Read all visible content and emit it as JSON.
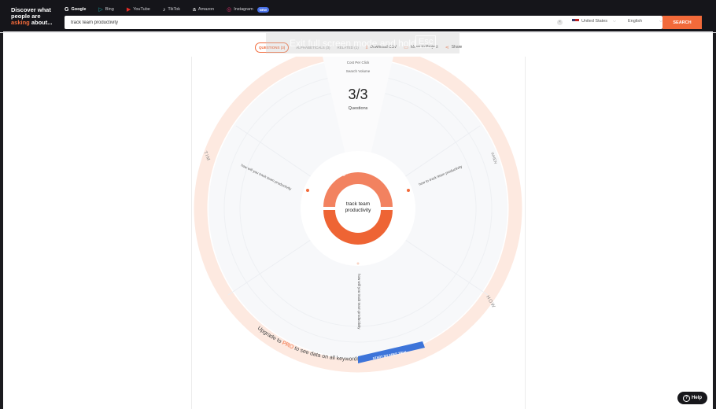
{
  "brand": {
    "line1": "Discover what",
    "line2": "people are",
    "line3_highlight": "asking",
    "line3_rest": " about..."
  },
  "engines": [
    {
      "label": "Google",
      "icon": "google-icon",
      "active": true
    },
    {
      "label": "Bing",
      "icon": "bing-icon",
      "active": false
    },
    {
      "label": "YouTube",
      "icon": "youtube-icon",
      "active": false
    },
    {
      "label": "TikTok",
      "icon": "tiktok-icon",
      "active": false
    },
    {
      "label": "Amazon",
      "icon": "amazon-icon",
      "active": false
    },
    {
      "label": "Instagram",
      "icon": "instagram-icon",
      "active": false,
      "badge": "NEW"
    }
  ],
  "search": {
    "value": "track team productivity",
    "country": "United States",
    "language": "English",
    "button": "SEARCH"
  },
  "tooltip": {
    "text": "Exit full screen mode and hold",
    "key": "Esc"
  },
  "tabs": [
    {
      "label": "QUESTIONS (3)",
      "active": true
    },
    {
      "label": "ALPHABETICALS (3)",
      "active": false
    },
    {
      "label": "RELATED (1)",
      "active": false
    }
  ],
  "actions": [
    {
      "label": "Download CSV",
      "icon": "download-icon"
    },
    {
      "label": "Move to Project",
      "icon": "folder-icon"
    },
    {
      "label": "Share",
      "icon": "share-icon"
    }
  ],
  "wheel": {
    "legend_top": "Cost Per Click",
    "legend_bottom": "Search Volume",
    "count": "3/3",
    "count_label": "Questions",
    "center": [
      "track team",
      "productivity"
    ],
    "ring_top": "Search Volume",
    "ring_bottom": "Cost Per Click",
    "segment_labels": {
      "left": "TIM",
      "right": "WHEN",
      "bottom_right": "HOW"
    },
    "questions": [
      "how will you track team productivity",
      "how to track team productivity",
      "how will you track team productivity"
    ],
    "upgrade_prefix": "Upgrade to ",
    "upgrade_pro": "PRO",
    "upgrade_suffix": " to see data on all keywords",
    "trial_button": "START MY FREE TRIAL"
  },
  "help": {
    "label": "Help"
  },
  "colors": {
    "accent": "#f26a3a",
    "dark": "#15151a",
    "blue": "#4a72e8"
  }
}
